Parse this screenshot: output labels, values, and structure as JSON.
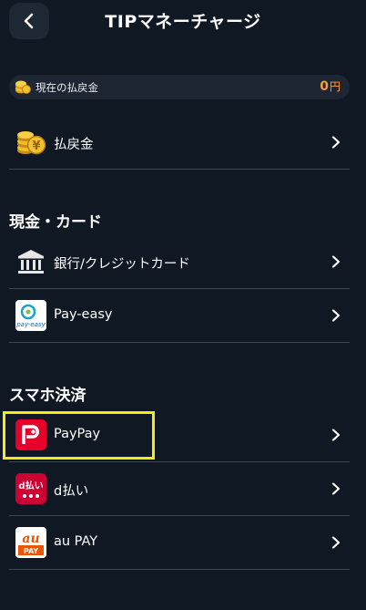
{
  "header": {
    "title": "TIPマネーチャージ"
  },
  "balance": {
    "label": "現在の払戻金",
    "value": "0",
    "unit": "円"
  },
  "refund": {
    "label": "払戻金"
  },
  "sections": [
    {
      "title": "現金・カード",
      "items": [
        {
          "label": "銀行/クレジットカード"
        },
        {
          "label": "Pay-easy"
        }
      ]
    },
    {
      "title": "スマホ決済",
      "items": [
        {
          "label": "PayPay"
        },
        {
          "label": "d払い"
        },
        {
          "label": "au PAY"
        }
      ]
    }
  ],
  "icons": {
    "payeasy_text": "pay-easy",
    "dpay_text": "d払い",
    "au_text": "au",
    "au_pay_text": "PAY"
  },
  "colors": {
    "background": "#0f1823",
    "accent_orange": "#ff9a3c",
    "highlight": "#f5ea14",
    "paypay_red": "#e8002d",
    "dpay_red": "#cc0033",
    "au_orange": "#eb5505"
  }
}
